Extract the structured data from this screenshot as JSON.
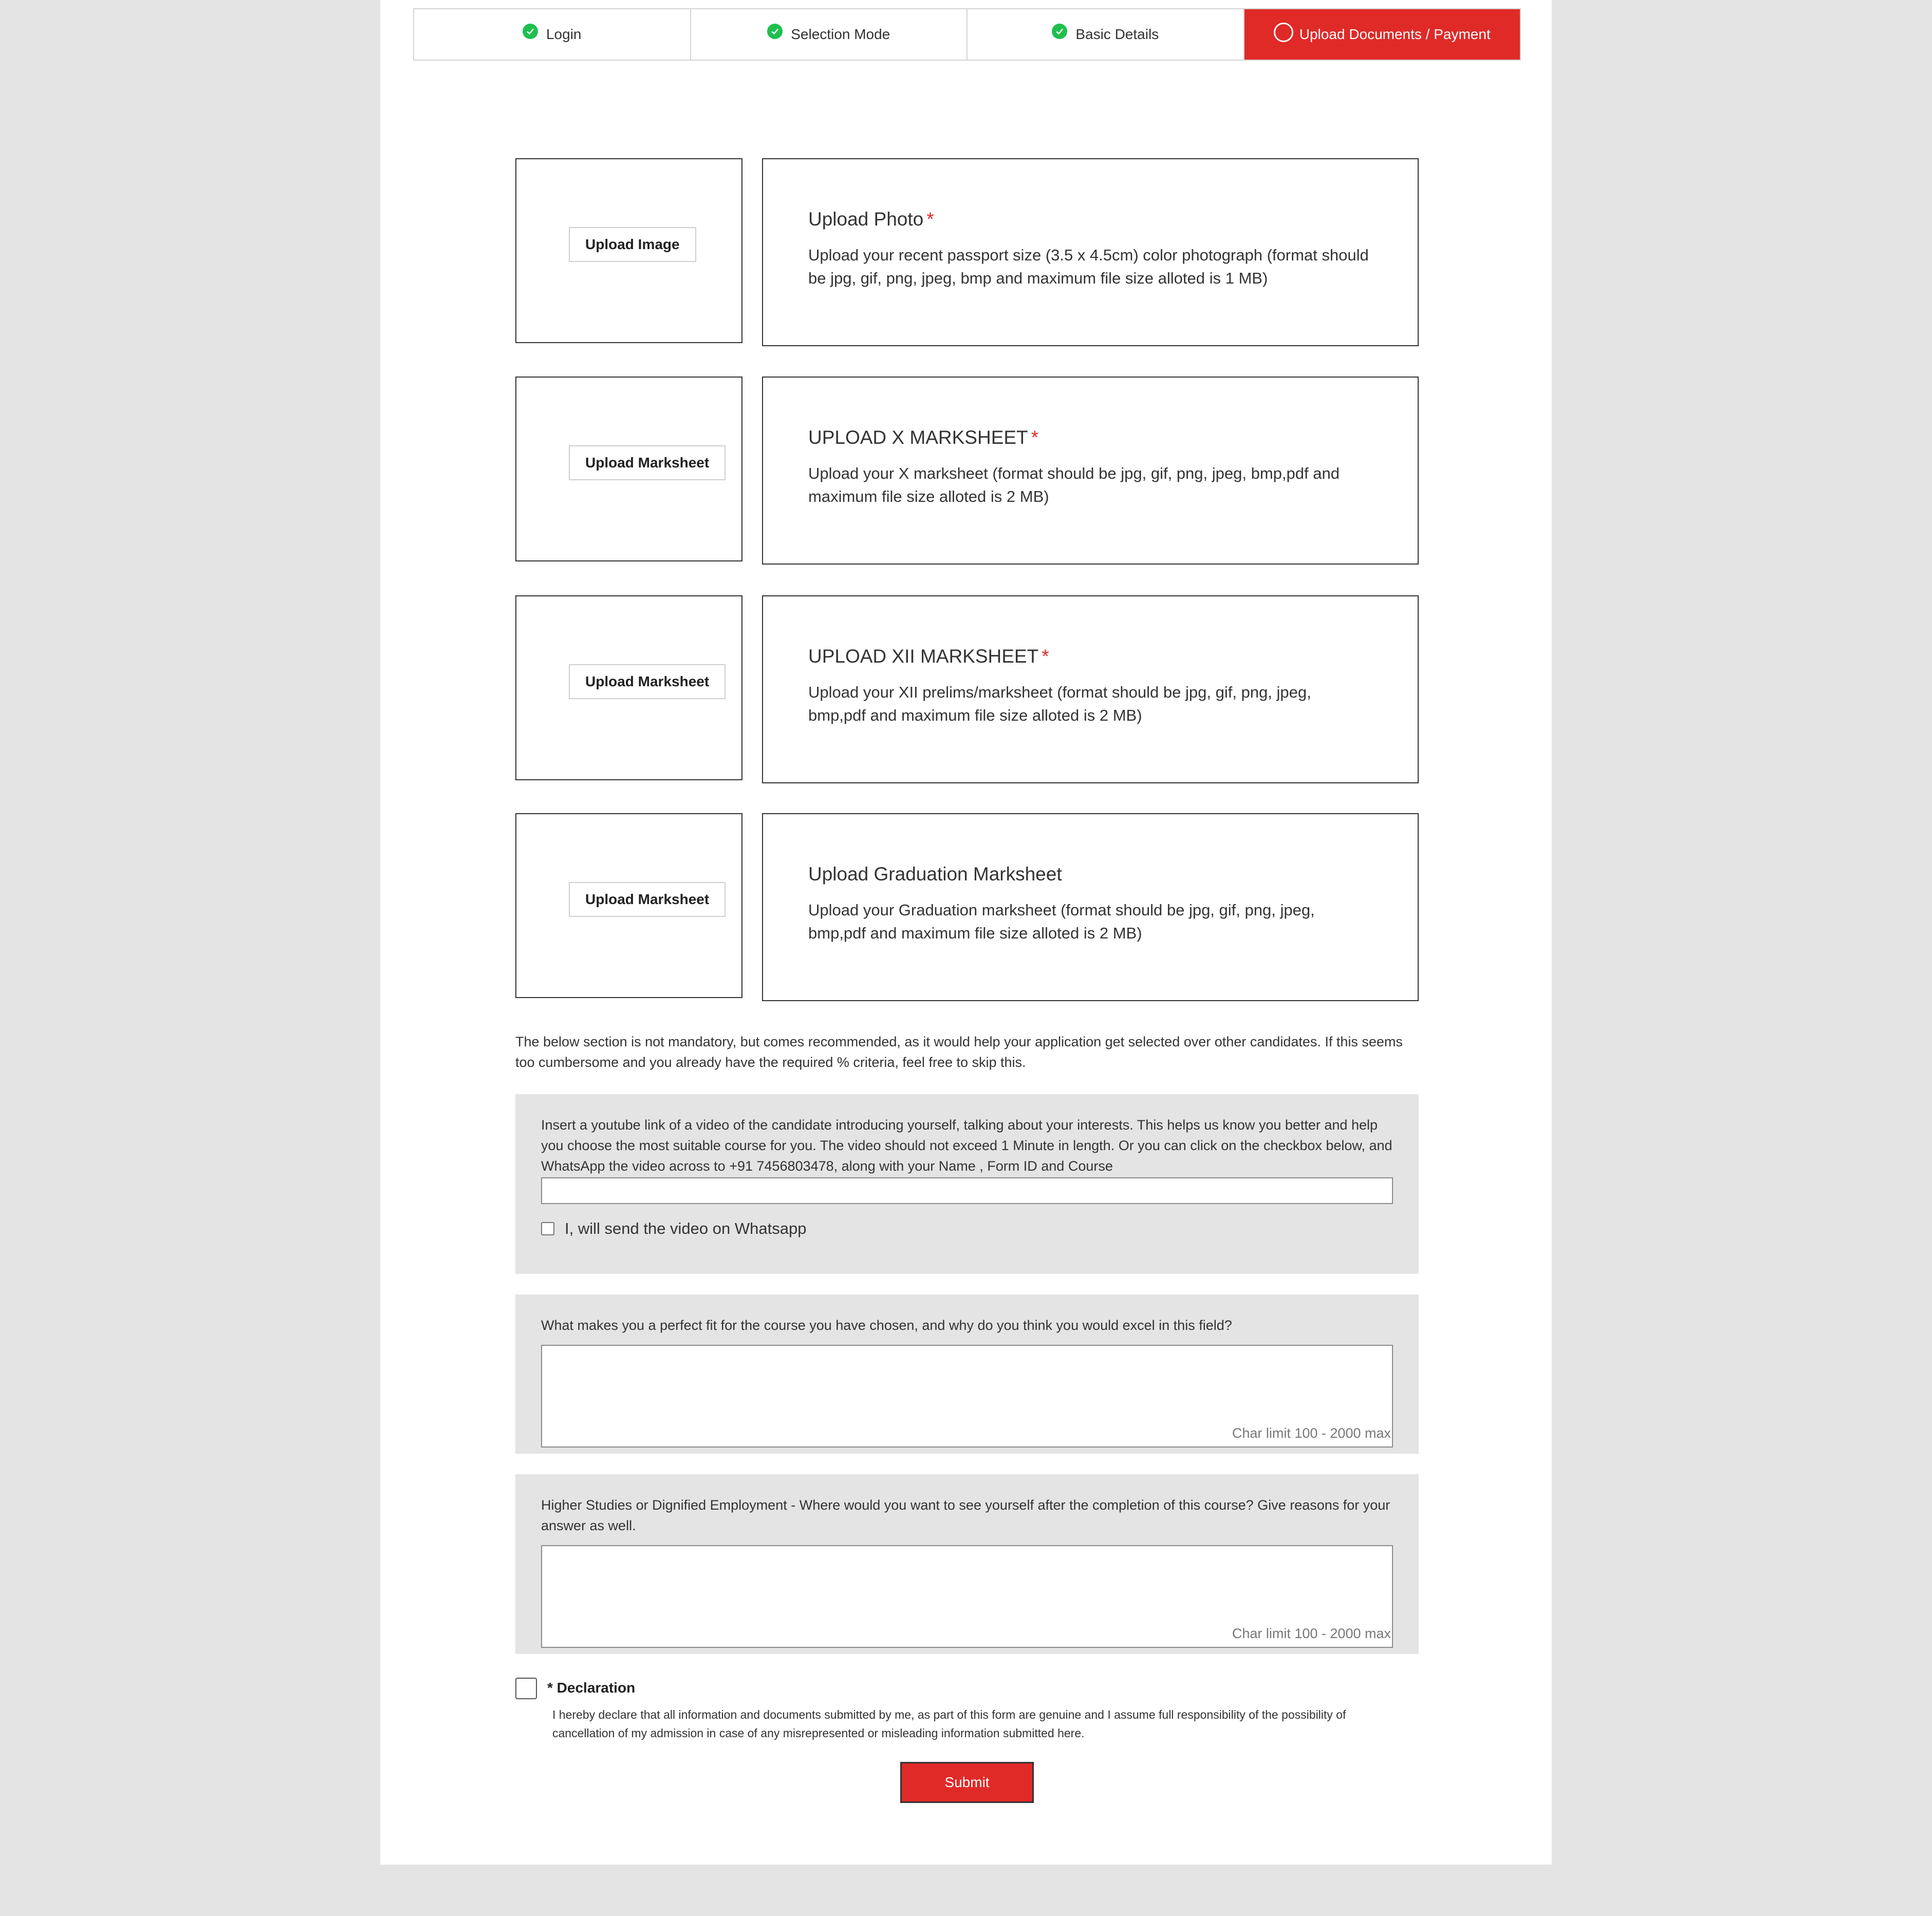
{
  "steps": [
    {
      "label": "Login",
      "status": "done"
    },
    {
      "label": "Selection Mode",
      "status": "done"
    },
    {
      "label": "Basic Details",
      "status": "done"
    },
    {
      "label": "Upload Documents / Payment",
      "status": "current"
    }
  ],
  "uploads": [
    {
      "button": "Upload Image",
      "title": "Upload Photo",
      "required_mark": "*",
      "description": "Upload your recent passport size (3.5 x 4.5cm) color photograph (format should be jpg, gif, png, jpeg, bmp and maximum file size alloted is 1 MB)"
    },
    {
      "button": "Upload Marksheet",
      "title": "UPLOAD X MARKSHEET",
      "required_mark": "*",
      "description": "Upload your X marksheet (format should be jpg, gif, png, jpeg, bmp,pdf and maximum file size alloted is 2 MB)"
    },
    {
      "button": "Upload Marksheet",
      "title": "UPLOAD XII MARKSHEET",
      "required_mark": "*",
      "description": "Upload your XII prelims/marksheet (format should be jpg, gif, png, jpeg, bmp,pdf and maximum file size alloted is 2 MB)"
    },
    {
      "button": "Upload Marksheet",
      "title": "Upload Graduation Marksheet",
      "required_mark": "",
      "description": "Upload your Graduation marksheet (format should be jpg, gif, png, jpeg, bmp,pdf and maximum file size alloted is 2 MB)"
    }
  ],
  "optional_note": "The below section is not mandatory, but comes recommended, as it would help your application get selected over other candidates. If this seems too cumbersome and you already have the required % criteria, feel free to skip this.",
  "video": {
    "instructions": "Insert a youtube link of a video of the candidate introducing yourself, talking about your interests. This helps us know you better and help you choose the most suitable course for you. The video should not exceed 1 Minute in length. Or you can click on the checkbox below, and WhatsApp the video across to +91 7456803478, along with your Name , Form ID and Course",
    "link_value": "",
    "checkbox_label": "I, will send the video on Whatsapp"
  },
  "question1": {
    "prompt": "What makes you a perfect fit for the course you have chosen, and why do you think you would excel in this field?",
    "char_limit": "Char limit 100 - 2000 max"
  },
  "question2": {
    "prompt": "Higher Studies or Dignified Employment - Where would you want to see yourself after the completion of this course? Give reasons for your answer as well.",
    "char_limit": "Char limit 100 - 2000 max"
  },
  "declaration": {
    "title": "* Declaration",
    "text": "I hereby declare that all information and documents submitted by me, as part of this form are genuine and I assume full responsibility of the possibility of cancellation of my admission in case of any misrepresented or misleading information submitted here."
  },
  "submit_label": "Submit",
  "colors": {
    "accent": "#df2a28",
    "done": "#1fbf4f",
    "gray_bg": "#e4e4e4"
  }
}
